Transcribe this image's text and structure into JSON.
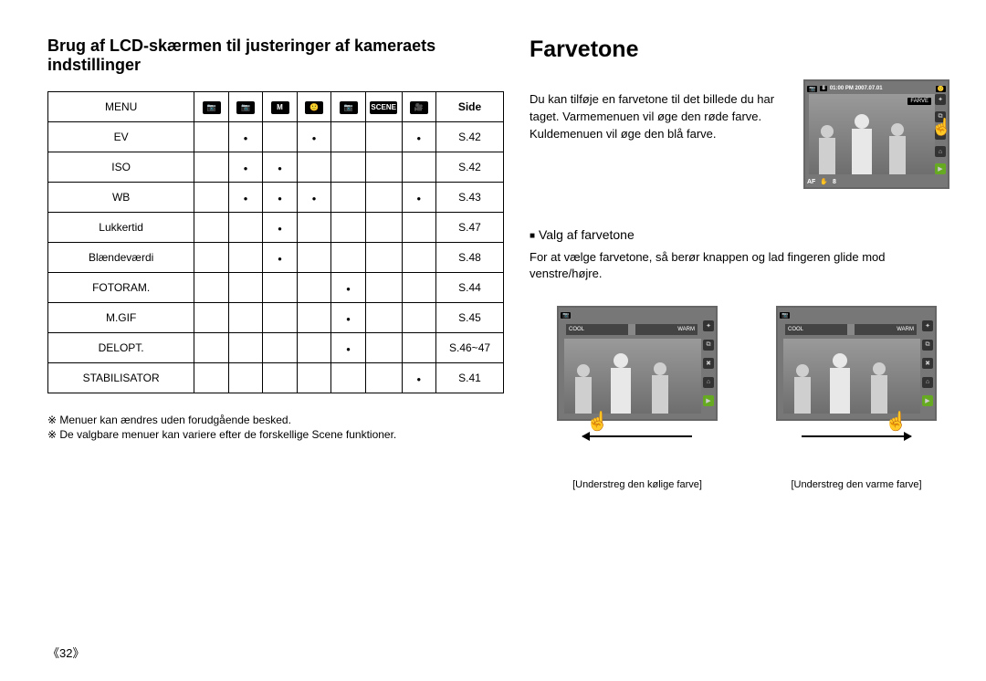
{
  "left": {
    "title": "Brug af LCD-skærmen til justeringer af kameraets indstillinger",
    "table": {
      "head_first": "MENU",
      "mode_icons": [
        "📷",
        "📷",
        "M",
        "🙂",
        "📷",
        "SCENE",
        "🎥"
      ],
      "head_last": "Side",
      "rows": [
        {
          "label": "EV",
          "cols": [
            "",
            "●",
            "",
            "●",
            "",
            "",
            "●"
          ],
          "page": "S.42"
        },
        {
          "label": "ISO",
          "cols": [
            "",
            "●",
            "●",
            "",
            "",
            "",
            ""
          ],
          "page": "S.42"
        },
        {
          "label": "WB",
          "cols": [
            "",
            "●",
            "●",
            "●",
            "",
            "",
            "●"
          ],
          "page": "S.43"
        },
        {
          "label": "Lukkertid",
          "cols": [
            "",
            "",
            "●",
            "",
            "",
            "",
            ""
          ],
          "page": "S.47"
        },
        {
          "label": "Blændeværdi",
          "cols": [
            "",
            "",
            "●",
            "",
            "",
            "",
            ""
          ],
          "page": "S.48"
        },
        {
          "label": "FOTORAM.",
          "cols": [
            "",
            "",
            "",
            "",
            "●",
            "",
            ""
          ],
          "page": "S.44"
        },
        {
          "label": "M.GIF",
          "cols": [
            "",
            "",
            "",
            "",
            "●",
            "",
            ""
          ],
          "page": "S.45"
        },
        {
          "label": "DELOPT.",
          "cols": [
            "",
            "",
            "",
            "",
            "●",
            "",
            ""
          ],
          "page": "S.46~47"
        },
        {
          "label": "STABILISATOR",
          "cols": [
            "",
            "",
            "",
            "",
            "",
            "",
            "●"
          ],
          "page": "S.41"
        }
      ]
    },
    "footnote1": "※ Menuer kan ændres uden forudgående besked.",
    "footnote2": "※ De valgbare menuer kan variere efter de forskellige Scene funktioner."
  },
  "right": {
    "title": "Farvetone",
    "intro": "Du kan tilføje en farvetone til det billede du har taget. Varmemenuen vil øge den røde farve. Kuldemenuen vil øge den blå farve.",
    "lcd": {
      "count": "8",
      "time": "01:00 PM 2007.07.01",
      "farve": "FARVE",
      "af": "AF",
      "af_val": "8"
    },
    "section_head": "Valg af farvetone",
    "section_body": "For at vælge farvetone, så berør knappen og lad fingeren glide mod venstre/højre.",
    "slider_cool": "COOL",
    "slider_warm": "WARM",
    "caption_left": "[Understreg den kølige farve]",
    "caption_right": "[Understreg den varme farve]"
  },
  "page_number": "《32》"
}
